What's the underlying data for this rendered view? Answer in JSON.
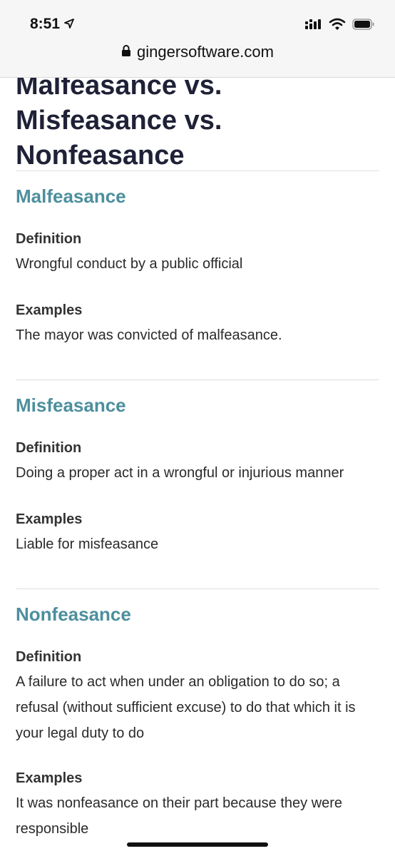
{
  "status_bar": {
    "time": "8:51",
    "icons": [
      "location-arrow-icon",
      "signal-icon",
      "wifi-icon",
      "battery-icon"
    ]
  },
  "browser": {
    "url": "gingersoftware.com",
    "icon": "lock-icon"
  },
  "article": {
    "title": "Malfeasance vs. Misfeasance vs. Nonfeasance",
    "sections": [
      {
        "term": "Malfeasance",
        "definition_label": "Definition",
        "definition": "Wrongful conduct by a public official",
        "examples_label": "Examples",
        "examples": "The mayor was convicted of malfeasance."
      },
      {
        "term": "Misfeasance",
        "definition_label": "Definition",
        "definition": "Doing a proper act in a wrongful or injurious manner",
        "examples_label": "Examples",
        "examples": "Liable for misfeasance"
      },
      {
        "term": "Nonfeasance",
        "definition_label": "Definition",
        "definition": "A failure to act when under an obligation to do so; a refusal (without sufficient excuse) to do that which it is your legal duty to do",
        "examples_label": "Examples",
        "examples": "It was nonfeasance on their part because they were responsible"
      }
    ]
  },
  "colors": {
    "title": "#1f2137",
    "term": "#4c8f9d",
    "divider": "#dedede",
    "topbar": "#f6f6f6"
  }
}
